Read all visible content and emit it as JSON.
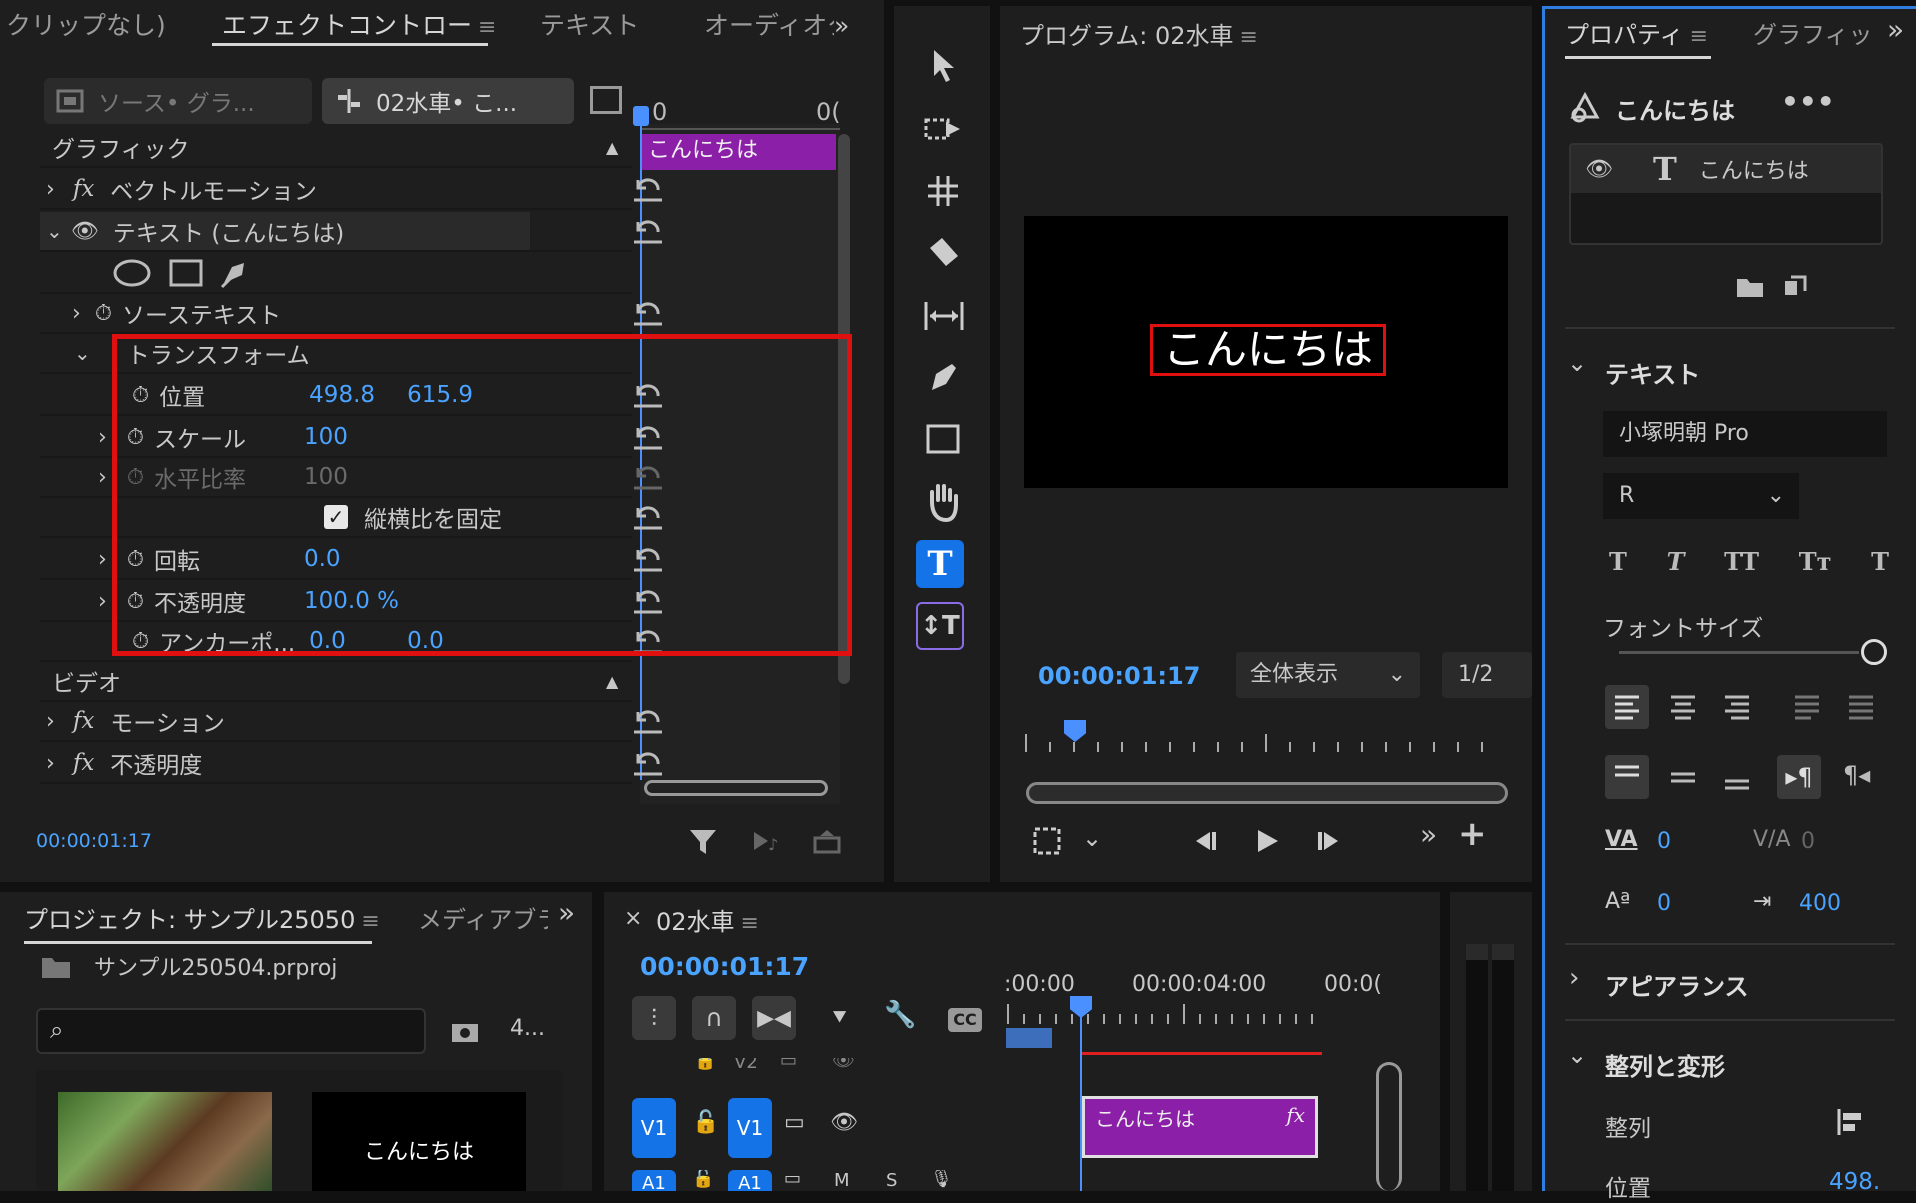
{
  "effects_panel": {
    "tabs": [
      "クリップなし)",
      "エフェクトコントロー",
      "テキスト",
      "オーディオク"
    ],
    "source_tab": "ソース• グラ...",
    "clip_tab": "02水車• こ...",
    "section_graphic": "グラフィック",
    "vector_motion": "ベクトルモーション",
    "text_layer": "テキスト (こんにちは)",
    "source_text": "ソーステキスト",
    "transform": "トランスフォーム",
    "position_label": "位置",
    "position_x": "498.8",
    "position_y": "615.9",
    "scale_label": "スケール",
    "scale_value": "100",
    "hscale_label": "水平比率",
    "hscale_value": "100",
    "lock_ratio": "縦横比を固定",
    "rotation_label": "回転",
    "rotation_value": "0.0",
    "opacity_label": "不透明度",
    "opacity_value": "100.0 %",
    "anchor_label": "アンカーポ...",
    "anchor_x": "0.0",
    "anchor_y": "0.0",
    "section_video": "ビデオ",
    "motion": "モーション",
    "opacity_fx": "不透明度",
    "timecode": "00:00:01:17",
    "clip_label": "こんにちは",
    "ruler_left": "0",
    "ruler_right": "0("
  },
  "program_monitor": {
    "title": "プログラム: 02水車",
    "overlay_text": "こんにちは",
    "timecode": "00:00:01:17",
    "zoom": "全体表示",
    "resolution": "1/2"
  },
  "properties_panel": {
    "tabs": [
      "プロパティ",
      "グラフィッ"
    ],
    "header_title": "こんにちは",
    "layer_name": "こんにちは",
    "section_text": "テキスト",
    "font_name": "小塚明朝 Pro",
    "font_style": "R",
    "font_size_label": "フォントサイズ",
    "kerning": "0",
    "tracking": "0",
    "baseline": "0",
    "tab_width": "400",
    "section_appearance": "アピアランス",
    "section_align": "整列と変形",
    "align_label": "整列",
    "position_label": "位置",
    "position_value": "498."
  },
  "project_panel": {
    "tabs": [
      "プロジェクト: サンプル25050",
      "メディアブラ"
    ],
    "file_name": "サンプル250504.prproj",
    "item_count": "4...",
    "thumb_text": "こんにちは"
  },
  "timeline": {
    "title": "02水車",
    "timecode": "00:00:01:17",
    "ruler": [
      ":00:00",
      "00:00:04:00",
      "00:0("
    ],
    "clip_label": "こんにちは",
    "fx_badge": "fx",
    "track_v1": "V1",
    "track_v2": "V2",
    "track_a1": "A1",
    "mute": "M",
    "solo": "S"
  }
}
